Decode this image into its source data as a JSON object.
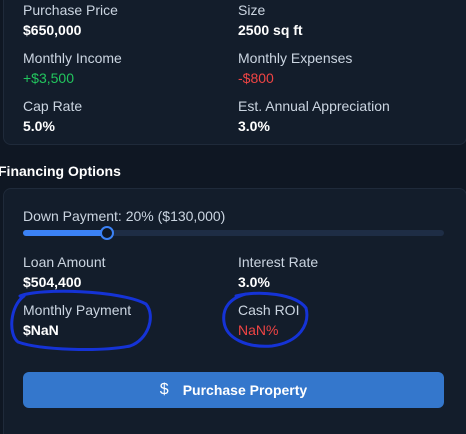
{
  "property": {
    "purchase_price_label": "Purchase Price",
    "purchase_price_value": "$650,000",
    "size_label": "Size",
    "size_value": "2500 sq ft",
    "monthly_income_label": "Monthly Income",
    "monthly_income_value": "+$3,500",
    "monthly_expenses_label": "Monthly Expenses",
    "monthly_expenses_value": "-$800",
    "cap_rate_label": "Cap Rate",
    "cap_rate_value": "5.0%",
    "appreciation_label": "Est. Annual Appreciation",
    "appreciation_value": "3.0%"
  },
  "financing": {
    "title": "Financing Options",
    "down_payment_label": "Down Payment: 20% ($130,000)",
    "down_payment_percent": 20,
    "loan_amount_label": "Loan Amount",
    "loan_amount_value": "$504,400",
    "interest_rate_label": "Interest Rate",
    "interest_rate_value": "3.0%",
    "monthly_payment_label": "Monthly Payment",
    "monthly_payment_value": "$NaN",
    "cash_roi_label": "Cash ROI",
    "cash_roi_value": "NaN%",
    "purchase_button_label": "Purchase Property",
    "purchase_button_icon": "dollar-icon"
  },
  "colors": {
    "accent": "#3b82f6",
    "positive": "#22c55e",
    "negative": "#ef4444",
    "annotation_ink": "#1533d6"
  }
}
